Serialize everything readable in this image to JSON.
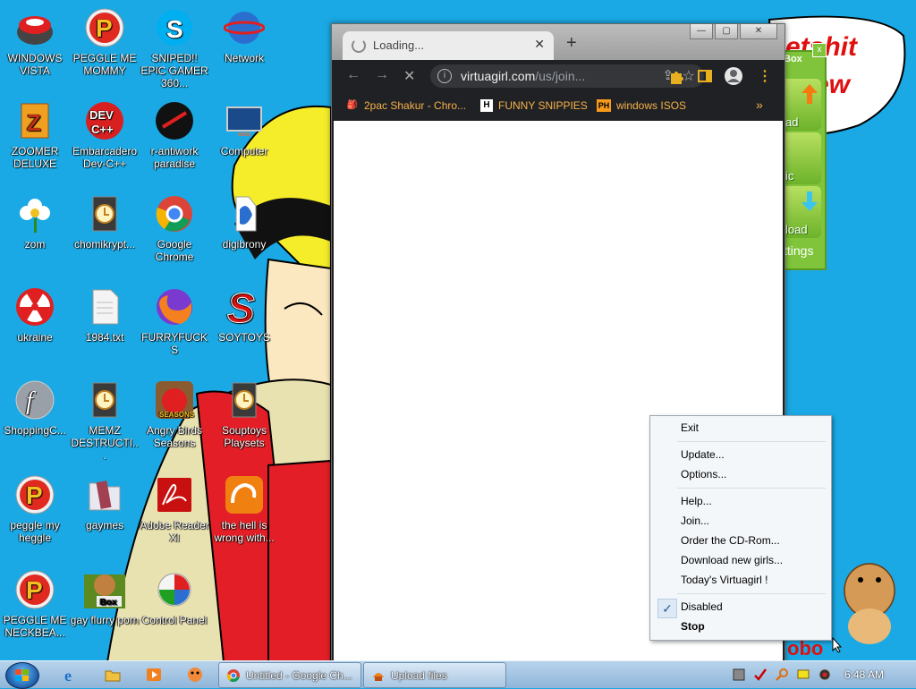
{
  "desktop_icons": [
    {
      "label": "WINDOWS VISTA",
      "icon": "bowl-icon"
    },
    {
      "label": "PEGGLE ME MOMMY",
      "icon": "peggle-icon"
    },
    {
      "label": "SNIPED!! EPIC GAMER 360...",
      "icon": "skype-icon"
    },
    {
      "label": "Network",
      "icon": "network-icon"
    },
    {
      "label": "ZOOMER DELUXE",
      "icon": "zoomer-icon"
    },
    {
      "label": "Embarcadero Dev-C++",
      "icon": "devcpp-icon"
    },
    {
      "label": "r-antiwork paradise",
      "icon": "antiwork-icon"
    },
    {
      "label": "Computer",
      "icon": "computer-icon"
    },
    {
      "label": "zom",
      "icon": "flower-icon"
    },
    {
      "label": "chomikrypt...",
      "icon": "shortcut-icon"
    },
    {
      "label": "Google Chrome",
      "icon": "chrome-icon"
    },
    {
      "label": "digibrony",
      "icon": "digibrony-icon"
    },
    {
      "label": "ukraine",
      "icon": "radiation-icon"
    },
    {
      "label": "1984.txt",
      "icon": "textfile-icon"
    },
    {
      "label": "FURRYFUCKS",
      "icon": "firefox-icon"
    },
    {
      "label": "SOYTOYS",
      "icon": "soytoys-icon"
    },
    {
      "label": "ShoppingC...",
      "icon": "flash-icon"
    },
    {
      "label": "MEMZ DESTRUCTI...",
      "icon": "shortcut-icon"
    },
    {
      "label": "Angry Birds Seasons",
      "icon": "angrybirds-icon"
    },
    {
      "label": "Souptoys Playsets",
      "icon": "shortcut-icon"
    },
    {
      "label": "peggle my heggle",
      "icon": "peggle-icon"
    },
    {
      "label": "gaymes",
      "icon": "folder-icon"
    },
    {
      "label": "Adobe Reader XI",
      "icon": "adobe-icon"
    },
    {
      "label": "the hell is wrong with...",
      "icon": "ucbrowser-icon"
    },
    {
      "label": "PEGGLE ME NECKBEA...",
      "icon": "peggle-icon"
    },
    {
      "label": "gay flurry porn",
      "icon": "bonzi-box-icon"
    },
    {
      "label": "Control Panel",
      "icon": "controlpanel-icon"
    }
  ],
  "box_badge": "Box",
  "browser": {
    "tab_title": "Loading...",
    "tab_close": "✕",
    "new_tab": "+",
    "url_host": "virtuagirl.com",
    "url_path": "/us/join...",
    "bookmarks": [
      {
        "label": "2pac Shakur - Chro...",
        "icon_text": "🎒"
      },
      {
        "label": "FUNNY SNIPPIES",
        "icon_text": "H"
      },
      {
        "label": "windows ISOS",
        "icon_text": "PH"
      }
    ],
    "more_bookmarks": "»"
  },
  "wallpaper_text": [
    "etshit",
    "ew"
  ],
  "green_panel": {
    "buttons": [
      "ad",
      "ic",
      "load"
    ],
    "footer": "ttings",
    "close": "x",
    "title": "Box"
  },
  "context_menu": {
    "items": [
      {
        "label": "Exit",
        "bold": false
      },
      {
        "label": "Update...",
        "bold": false
      },
      {
        "label": "Options...",
        "bold": false
      },
      {
        "label": "Help...",
        "bold": false
      },
      {
        "label": "Join...",
        "bold": false
      },
      {
        "label": "Order the CD-Rom...",
        "bold": false
      },
      {
        "label": "Download new girls...",
        "bold": false
      },
      {
        "label": "Today's Virtuagirl !",
        "bold": false
      },
      {
        "label": "Disabled",
        "bold": false,
        "checked": true
      },
      {
        "label": "Stop",
        "bold": true
      }
    ],
    "check_mark": "✓"
  },
  "taskbar": {
    "buttons": [
      {
        "label": "Untitled - Google Ch...",
        "icon": "chrome-icon"
      },
      {
        "label": "Upload files",
        "icon": "upload-icon"
      }
    ],
    "clock": "6:48 AM"
  },
  "colors": {
    "desktop": "#1aa9e4",
    "accent_orange": "#f6b24a"
  }
}
